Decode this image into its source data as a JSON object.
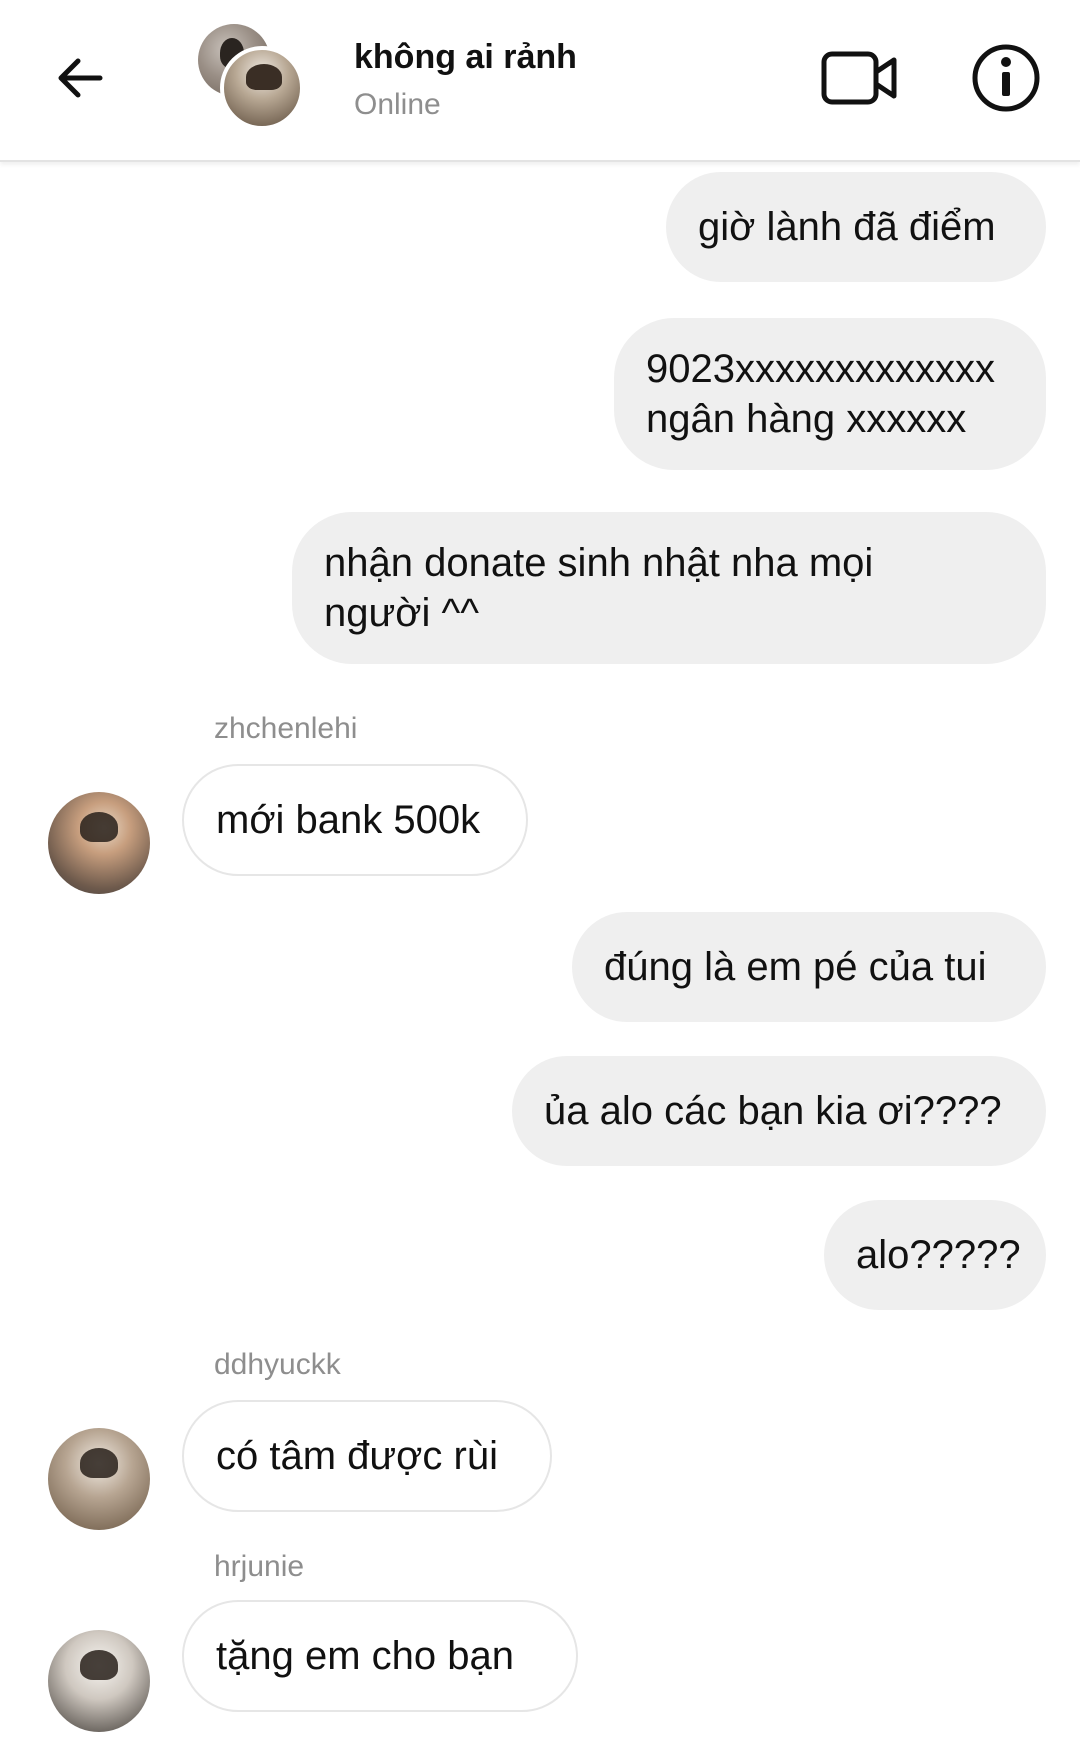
{
  "header": {
    "title": "không ai rảnh",
    "status": "Online",
    "back_icon": "arrow-left-icon",
    "video_icon": "video-camera-icon",
    "info_icon": "info-icon"
  },
  "messages": [
    {
      "direction": "out",
      "text": "giờ lành đã điểm"
    },
    {
      "direction": "out",
      "text": "9023xxxxxxxxxxxxx\nngân hàng xxxxxx"
    },
    {
      "direction": "out",
      "text": "nhận donate sinh nhật nha mọi\nngười ^^"
    },
    {
      "direction": "in",
      "sender": "zhchenlehi",
      "text": "mới bank 500k"
    },
    {
      "direction": "out",
      "text": "đúng là em pé của tui"
    },
    {
      "direction": "out",
      "text": "ủa alo các bạn kia ơi????"
    },
    {
      "direction": "out",
      "text": "alo?????"
    },
    {
      "direction": "in",
      "sender": "ddhyuckk",
      "text": "có tâm được rùi"
    },
    {
      "direction": "in",
      "sender": "hrjunie",
      "text": "tặng em cho bạn"
    }
  ]
}
